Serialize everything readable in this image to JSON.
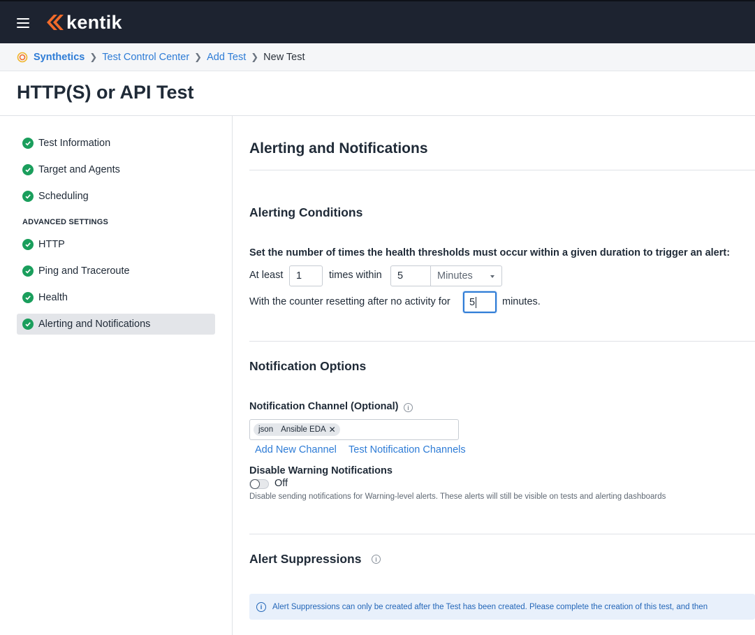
{
  "brand": {
    "name": "kentik",
    "accent": "#f26b2a",
    "topbar_color": "#1d2330"
  },
  "breadcrumbs": [
    "Synthetics",
    "Test Control Center",
    "Add Test",
    "New Test"
  ],
  "page_title": "HTTP(S) or API Test",
  "sidebar": {
    "items": [
      {
        "label": "Test Information",
        "status": "complete"
      },
      {
        "label": "Target and Agents",
        "status": "complete"
      },
      {
        "label": "Scheduling",
        "status": "complete"
      }
    ],
    "advanced_heading": "ADVANCED SETTINGS",
    "advanced_items": [
      {
        "label": "HTTP",
        "status": "complete"
      },
      {
        "label": "Ping and Traceroute",
        "status": "complete"
      },
      {
        "label": "Health",
        "status": "complete"
      },
      {
        "label": "Alerting and Notifications",
        "status": "complete",
        "active": true
      }
    ]
  },
  "main": {
    "title": "Alerting and Notifications",
    "alerting": {
      "title": "Alerting Conditions",
      "description": "Set the number of times the health thresholds must occur within a given duration to trigger an alert:",
      "at_least_label": "At least",
      "at_least_value": "1",
      "times_within_label": "times within",
      "within_value": "5",
      "unit": "Minutes",
      "reset_label": "With the counter resetting after no activity for",
      "reset_value": "5",
      "minutes_label": "minutes."
    },
    "notifications": {
      "title": "Notification Options",
      "channel_label": "Notification Channel (Optional)",
      "channels": [
        {
          "type": "json",
          "name": "Ansible EDA"
        }
      ],
      "add_channel": "Add New Channel",
      "test_channels": "Test Notification Channels",
      "disable_warning_label": "Disable Warning Notifications",
      "toggle_state": "Off",
      "disable_warning_hint": "Disable sending notifications for Warning-level alerts. These alerts will still be visible on tests and alerting dashboards"
    },
    "suppressions": {
      "title": "Alert Suppressions",
      "callout": "Alert Suppressions can only be created after the Test has been created. Please complete the creation of this test, and then"
    }
  }
}
